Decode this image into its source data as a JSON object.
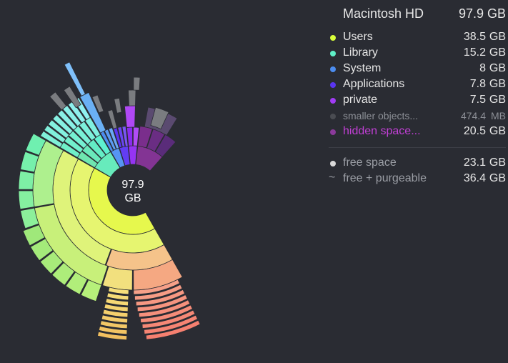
{
  "header": {
    "title": "Macintosh HD",
    "total": "97.9 GB"
  },
  "center": {
    "line1": "97.9",
    "line2": "GB"
  },
  "items": [
    {
      "label": "Users",
      "num": "38.5",
      "unit": "GB",
      "color": "#d9ff3a"
    },
    {
      "label": "Library",
      "num": "15.2",
      "unit": "GB",
      "color": "#5ff0c8"
    },
    {
      "label": "System",
      "num": "8",
      "unit": "GB",
      "color": "#4c8df0"
    },
    {
      "label": "Applications",
      "num": "7.8",
      "unit": "GB",
      "color": "#5a35f0"
    },
    {
      "label": "private",
      "num": "7.5",
      "unit": "GB",
      "color": "#a13cf5"
    },
    {
      "label": "smaller objects...",
      "num": "474.4",
      "unit": "MB",
      "color": "#4a4c52"
    },
    {
      "label": "hidden space...",
      "num": "20.5",
      "unit": "GB",
      "color": "#8b3a9b"
    }
  ],
  "free": [
    {
      "icon": "dot-icon",
      "label": "free space",
      "num": "23.1",
      "unit": "GB",
      "color": "#d9d9d9"
    },
    {
      "icon": "tilde-icon",
      "label": "free + purgeable",
      "num": "36.4",
      "unit": "GB",
      "symbol": "~"
    }
  ]
}
